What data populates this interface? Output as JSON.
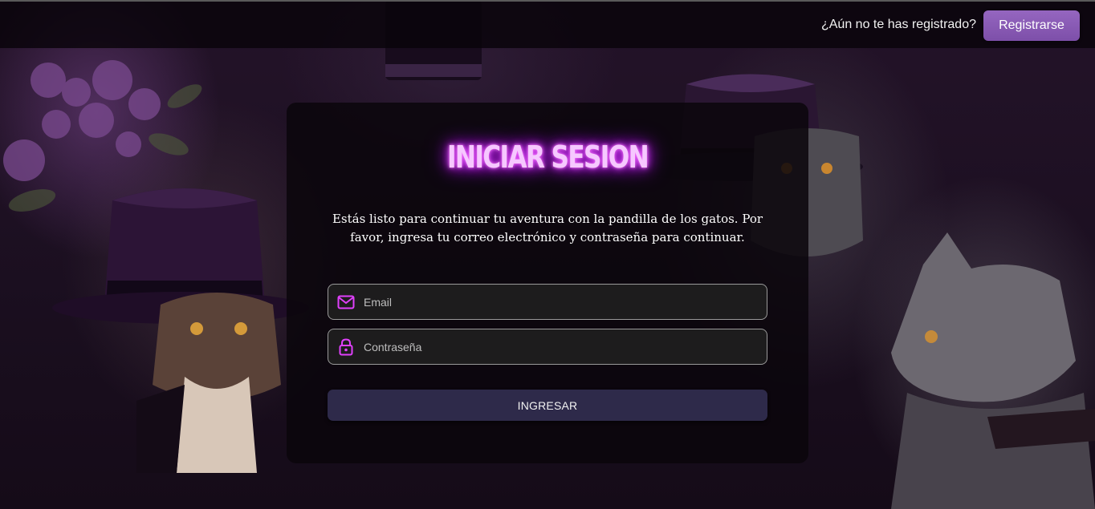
{
  "header": {
    "prompt": "¿Aún no te has registrado?",
    "register_label": "Registrarse"
  },
  "login": {
    "title": "INICIAR SESION",
    "description": "Estás listo para continuar tu aventura con la pandilla de los gatos. Por favor, ingresa tu correo electrónico y contraseña para continuar.",
    "email_placeholder": "Email",
    "password_placeholder": "Contraseña",
    "submit_label": "INGRESAR",
    "email_icon": "mail-icon",
    "password_icon": "lock-icon"
  },
  "colors": {
    "accent": "#e040fb",
    "register_button": "#8a5bb6",
    "submit_button": "#2e2a4a",
    "title_glow": "#c81bff"
  }
}
